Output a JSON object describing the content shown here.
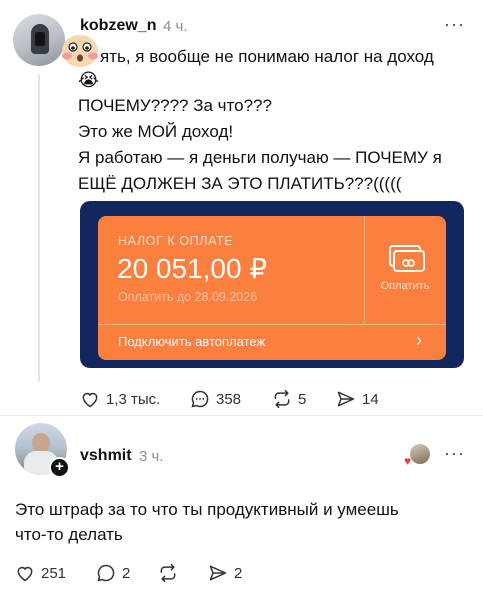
{
  "post": {
    "username": "kobzew_n",
    "time": "4 ч.",
    "more": "···",
    "line1": "ять, я вообще не понимаю налог на доход",
    "crying_emoji": "😭",
    "line2": "ПОЧЕМУ???? За что???",
    "line3": "Это же МОЙ доход!",
    "line4": "Я работаю — я деньги получаю — ПОЧЕМУ я",
    "line5": "ЕЩЁ ДОЛЖЕН ЗА ЭТО ПЛАТИТЬ???(((((",
    "tax_card": {
      "title": "НАЛОГ К ОПЛАТЕ",
      "amount": "20 051,00 ₽",
      "due": "Оплатить до 28.09.2026",
      "pay_label": "Оплатить",
      "autopay_label": "Подключить автоплатеж",
      "chevron": "›",
      "colors": {
        "frame": "#12275e",
        "card": "#fb7f3e"
      }
    },
    "actions": {
      "likes": "1,3 тыс.",
      "comments": "358",
      "reposts": "5",
      "shares": "14"
    }
  },
  "reply": {
    "username": "vshmit",
    "time": "3 ч.",
    "more": "···",
    "follow_plus": "+",
    "text_line1": "Это штраф за то что ты продуктивный и умеешь",
    "text_line2": "что-то делать",
    "actions": {
      "likes": "251",
      "comments": "2",
      "shares": "2"
    }
  },
  "icons": {
    "like": "heart-icon",
    "comment": "comment-icon",
    "repost": "repost-icon",
    "share": "send-icon",
    "more": "more-icon"
  },
  "colors": {
    "accent_like": "#ff3040",
    "muted": "#8e8e93"
  }
}
